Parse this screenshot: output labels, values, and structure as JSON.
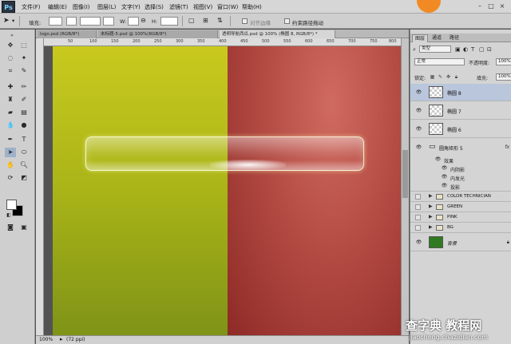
{
  "app": {
    "logo": "Ps"
  },
  "menu": [
    "文件(F)",
    "编辑(E)",
    "图像(I)",
    "图层(L)",
    "文字(Y)",
    "选择(S)",
    "滤镜(T)",
    "视图(V)",
    "窗口(W)",
    "帮助(H)"
  ],
  "options_bar": {
    "fill_label": "填充:",
    "w_label": "W:",
    "h_label": "H:",
    "checkbox1_label": "对齐边缘",
    "checkbox2_label": "约束路径拖动"
  },
  "doc_tabs": [
    {
      "label": "logo.psd (RGB/8*)",
      "active": false
    },
    {
      "label": "未标题-5.psd @ 100%(RGB/8*)",
      "active": false
    },
    {
      "label": "透明导航西瓜.psd @ 100% (椭圆 8, RGB/8*) *",
      "active": true
    }
  ],
  "ruler_ticks": [
    "50",
    "100",
    "150",
    "200",
    "250",
    "300",
    "350",
    "400",
    "450",
    "500",
    "550",
    "600",
    "650",
    "700",
    "750",
    "800"
  ],
  "status": {
    "zoom": "100%",
    "doc_info": "(72 ppi)"
  },
  "panels": {
    "tabs": [
      "图层",
      "通道",
      "路径"
    ],
    "kind_filter": "类型",
    "blend_mode": "正常",
    "opacity_label": "不透明度:",
    "opacity_value": "100%",
    "lock_label": "锁定:",
    "fill_label": "填充:",
    "fill_value": "100%"
  },
  "layers": [
    {
      "name": "椭圆 8",
      "selected": true
    },
    {
      "name": "椭圆 7",
      "selected": false
    },
    {
      "name": "椭圆 6",
      "selected": false
    },
    {
      "name": "圆角矩形 5",
      "fx": "fx"
    }
  ],
  "effects": {
    "header": "效果",
    "items": [
      "内阴影",
      "内发光",
      "投影"
    ]
  },
  "groups": [
    "COLOR TECHNICIAN",
    "GREEN",
    "PINK",
    "BG"
  ],
  "background_layer": {
    "name": "背景"
  },
  "watermark": {
    "main": "查字典 教程网",
    "url": "jiaocheng.chazidian.com"
  },
  "colors": {
    "canvas_left": "#b8bf1a",
    "canvas_right": "#b44c44",
    "selected_layer": "#b9c6dc",
    "brand_badge": "#f28a24"
  }
}
